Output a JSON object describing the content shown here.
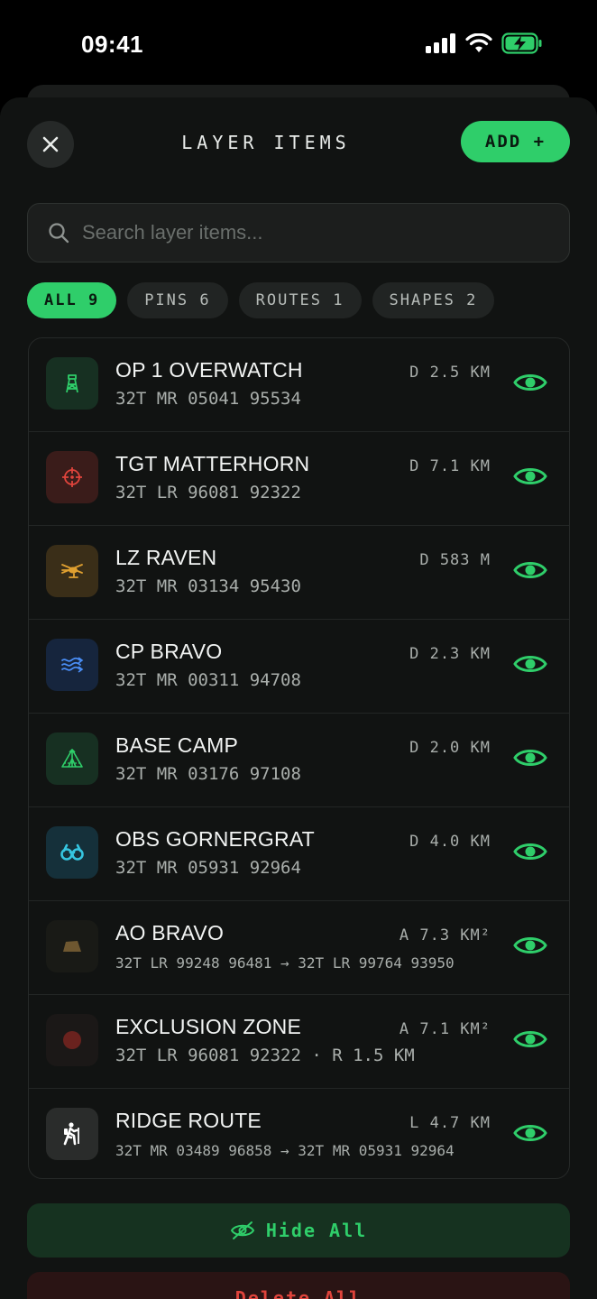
{
  "status_bar": {
    "time": "09:41"
  },
  "header": {
    "title": "LAYER ITEMS",
    "add_label": "ADD +"
  },
  "search": {
    "placeholder": "Search layer items..."
  },
  "filters": [
    {
      "label": "ALL 9",
      "active": true
    },
    {
      "label": "PINS 6",
      "active": false
    },
    {
      "label": "ROUTES 1",
      "active": false
    },
    {
      "label": "SHAPES 2",
      "active": false
    }
  ],
  "items": [
    {
      "name": "OP 1 OVERWATCH",
      "coord": "32T MR 05041 95534",
      "metric": "D 2.5 KM",
      "icon": "tower-icon",
      "color": "#2fce6a"
    },
    {
      "name": "TGT MATTERHORN",
      "coord": "32T LR 96081 92322",
      "metric": "D 7.1 KM",
      "icon": "crosshair-icon",
      "color": "#e0443c"
    },
    {
      "name": "LZ RAVEN",
      "coord": "32T MR 03134 95430",
      "metric": "D 583 M",
      "icon": "helicopter-icon",
      "color": "#e0a030"
    },
    {
      "name": "CP BRAVO",
      "coord": "32T MR 00311 94708",
      "metric": "D 2.3 KM",
      "icon": "checkpoint-icon",
      "color": "#3b82f6"
    },
    {
      "name": "BASE CAMP",
      "coord": "32T MR 03176 97108",
      "metric": "D 2.0 KM",
      "icon": "tent-icon",
      "color": "#2fce6a"
    },
    {
      "name": "OBS GORNERGRAT",
      "coord": "32T MR 05931 92964",
      "metric": "D 4.0 KM",
      "icon": "binoculars-icon",
      "color": "#36c5e0"
    },
    {
      "name": "AO BRAVO",
      "coord": "32T LR 99248 96481 → 32T LR 99764 93950",
      "metric": "A 7.3 KM²",
      "icon": "polygon-icon",
      "color": "#a37a33"
    },
    {
      "name": "EXCLUSION ZONE",
      "coord": "32T LR 96081 92322 · R 1.5 KM",
      "metric": "A 7.1 KM²",
      "icon": "circle-icon",
      "color": "#8a2a24"
    },
    {
      "name": "RIDGE ROUTE",
      "coord": "32T MR 03489 96858 → 32T MR 05931 92964",
      "metric": "L 4.7 KM",
      "icon": "hiker-icon",
      "color": "#ffffff"
    }
  ],
  "footer": {
    "hide_all": "Hide All",
    "delete_all": "Delete All"
  },
  "colors": {
    "accent": "#2fce6a",
    "danger": "#e0443c",
    "background": "#111312"
  }
}
